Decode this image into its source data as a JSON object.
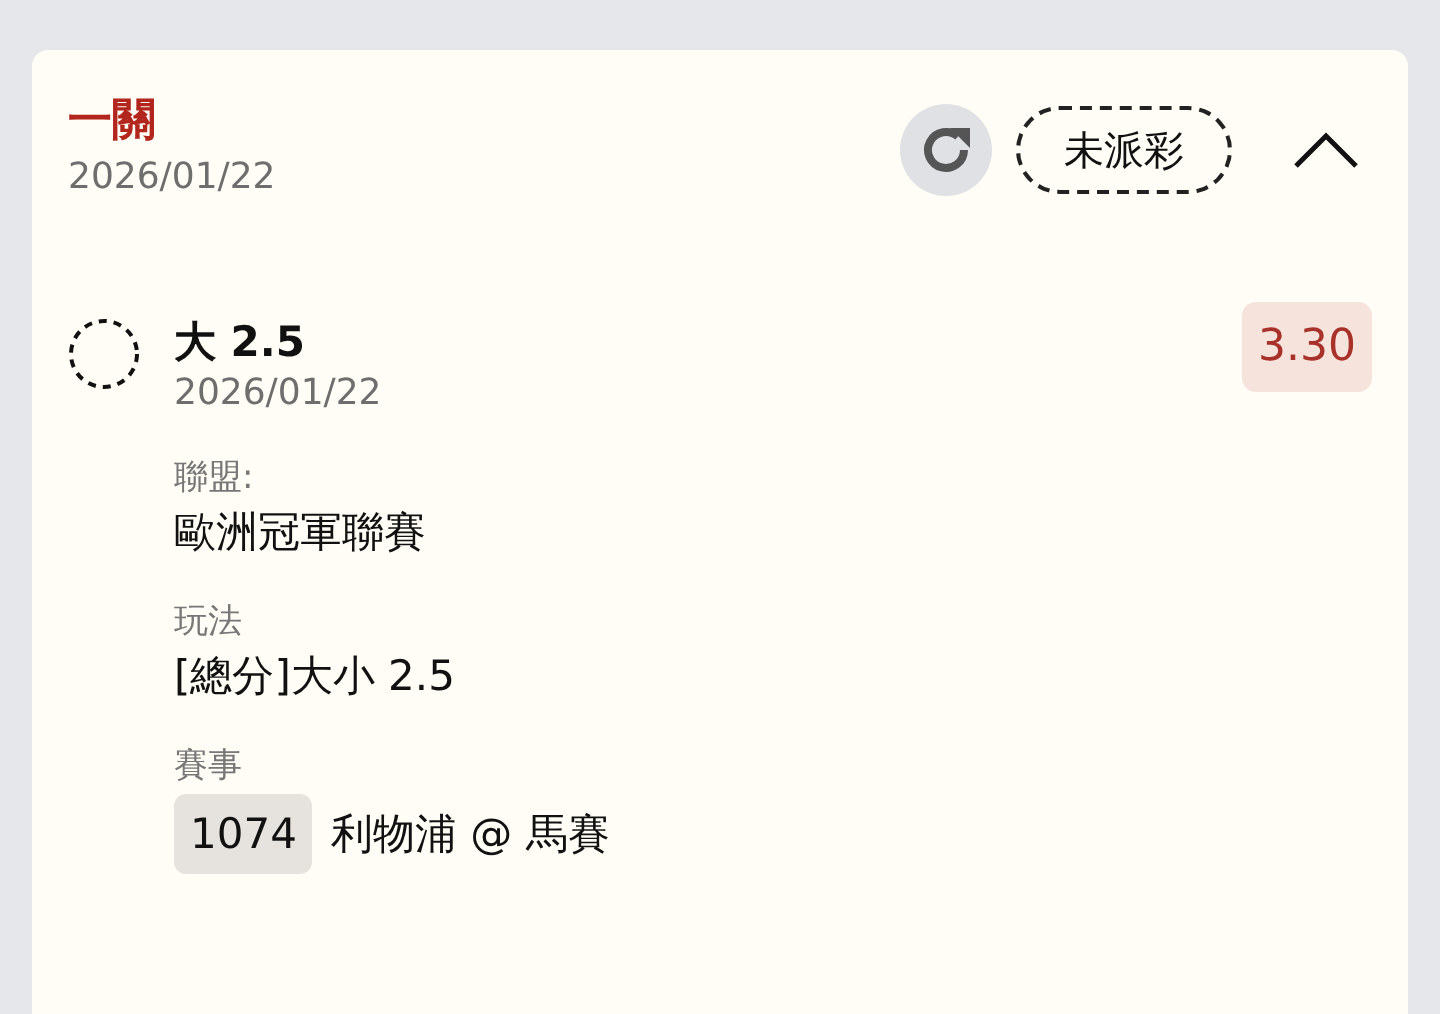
{
  "bet": {
    "title": "一關",
    "date": "2026/01/22",
    "status": "未派彩",
    "expanded": true,
    "selection": {
      "name": "大 2.5",
      "date": "2026/01/22",
      "odds": "3.30",
      "fields": [
        {
          "kind": "text",
          "label": "聯盟:",
          "value": "歐洲冠軍聯賽"
        },
        {
          "kind": "text",
          "label": "玩法",
          "value": "[總分]大小 2.5"
        },
        {
          "kind": "match",
          "label": "賽事",
          "code": "1074",
          "value": "利物浦 @ 馬賽"
        }
      ]
    }
  }
}
